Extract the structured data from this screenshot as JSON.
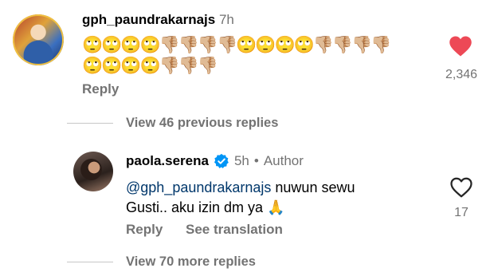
{
  "comment": {
    "username": "gph_paundrakarnajs",
    "time": "7h",
    "emoji_line1": "🙄🙄🙄🙄👎🏼👎🏼👎🏼👎🏼🙄🙄🙄🙄👎🏼👎🏼👎🏼👎🏼",
    "emoji_line2": "🙄🙄🙄🙄👎🏼👎🏼👎🏼",
    "reply_label": "Reply",
    "like_count": "2,346",
    "liked_color": "#ed4956"
  },
  "view_previous": "View 46 previous replies",
  "reply_comment": {
    "username": "paola.serena",
    "time": "5h",
    "separator": "•",
    "author_label": "Author",
    "mention": "@gph_paundrakarnajs",
    "text_line1": " nuwun sewu",
    "text_line2": "Gusti.. aku izin dm ya 🙏",
    "reply_label": "Reply",
    "translate_label": "See translation",
    "like_count": "17",
    "verified_color": "#0095f6"
  },
  "view_more": "View 70 more replies"
}
